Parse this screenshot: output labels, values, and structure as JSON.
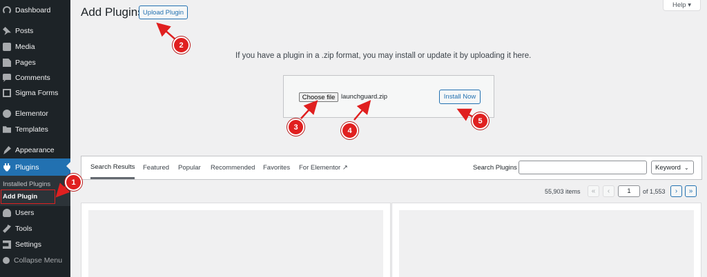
{
  "sidebar": {
    "items": [
      {
        "label": "Dashboard",
        "icon": "dashboard-icon"
      },
      {
        "label": "Posts",
        "icon": "pin-icon"
      },
      {
        "label": "Media",
        "icon": "media-icon"
      },
      {
        "label": "Pages",
        "icon": "pages-icon"
      },
      {
        "label": "Comments",
        "icon": "comment-icon"
      },
      {
        "label": "Sigma Forms",
        "icon": "forms-icon"
      },
      {
        "label": "Elementor",
        "icon": "elementor-icon"
      },
      {
        "label": "Templates",
        "icon": "folder-icon"
      },
      {
        "label": "Appearance",
        "icon": "brush-icon"
      },
      {
        "label": "Plugins",
        "icon": "plugin-icon"
      },
      {
        "label": "Users",
        "icon": "users-icon"
      },
      {
        "label": "Tools",
        "icon": "tools-icon"
      },
      {
        "label": "Settings",
        "icon": "settings-icon"
      },
      {
        "label": "Collapse Menu",
        "icon": "collapse-icon"
      }
    ],
    "submenu": [
      "Installed Plugins",
      "Add Plugin"
    ]
  },
  "header": {
    "title": "Add Plugins",
    "upload_button": "Upload Plugin",
    "help": "Help ▾"
  },
  "upload": {
    "instructions": "If you have a plugin in a .zip format, you may install or update it by uploading it here.",
    "choose_file": "Choose file",
    "file_name": "launchguard.zip",
    "install_button": "Install Now"
  },
  "filter": {
    "tabs": [
      "Search Results",
      "Featured",
      "Popular",
      "Recommended",
      "Favorites",
      "For Elementor ↗"
    ],
    "search_label": "Search Plugins",
    "search_value": "",
    "search_type": "Keyword"
  },
  "pagination": {
    "items": "55,903 items",
    "first": "«",
    "prev": "‹",
    "current_page": "1",
    "of": "of 1,553",
    "next": "›",
    "last": "»"
  },
  "annotations": [
    "1",
    "2",
    "3",
    "4",
    "5"
  ],
  "colors": {
    "accent": "#2271b1",
    "sidebar": "#1d2327",
    "annotation": "#e02020"
  }
}
